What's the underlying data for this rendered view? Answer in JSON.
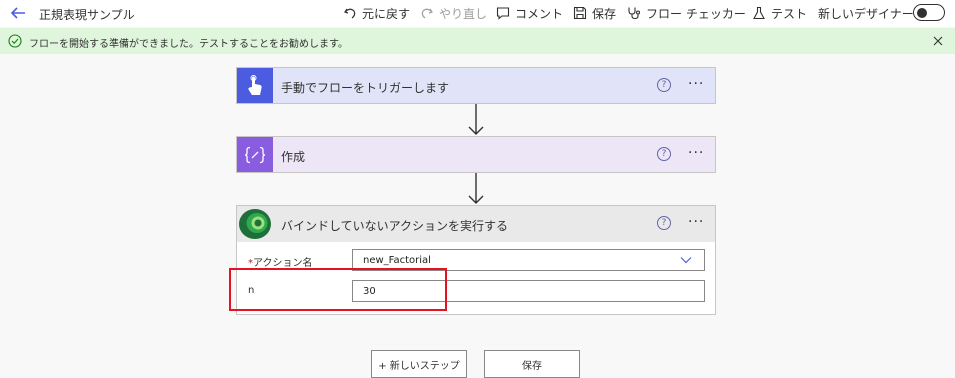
{
  "header": {
    "title": "正規表現サンプル",
    "undo_label": "元に戻す",
    "redo_label": "やり直し",
    "comment_label": "コメント",
    "save_label": "保存",
    "flow_checker_label": "フロー チェッカー",
    "test_label": "テスト",
    "new_designer_label": "新しいデザイナー",
    "new_designer_on": false
  },
  "banner": {
    "message": "フローを開始する準備ができました。テストすることをお勧めします。",
    "color": "#dff6dd"
  },
  "steps": [
    {
      "label": "手動でフローをトリガーします",
      "icon": "touch-hand-icon",
      "color": "#4c5ce0"
    },
    {
      "label": "作成",
      "icon": "compose-braces-icon",
      "color": "#8a5ce0"
    },
    {
      "label": "バインドしていないアクションを実行する",
      "icon": "dataverse-icon",
      "color": "#1f6f3a"
    }
  ],
  "help_glyph": "?",
  "more_glyph": "···",
  "action": {
    "fields": [
      {
        "label": "アクション名",
        "required_mark": "*",
        "value": "new_Factorial",
        "type": "dropdown"
      },
      {
        "label": "n",
        "value": "30",
        "type": "text"
      }
    ]
  },
  "footer": {
    "new_step_label": "+ 新しいステップ",
    "save_label": "保存"
  }
}
